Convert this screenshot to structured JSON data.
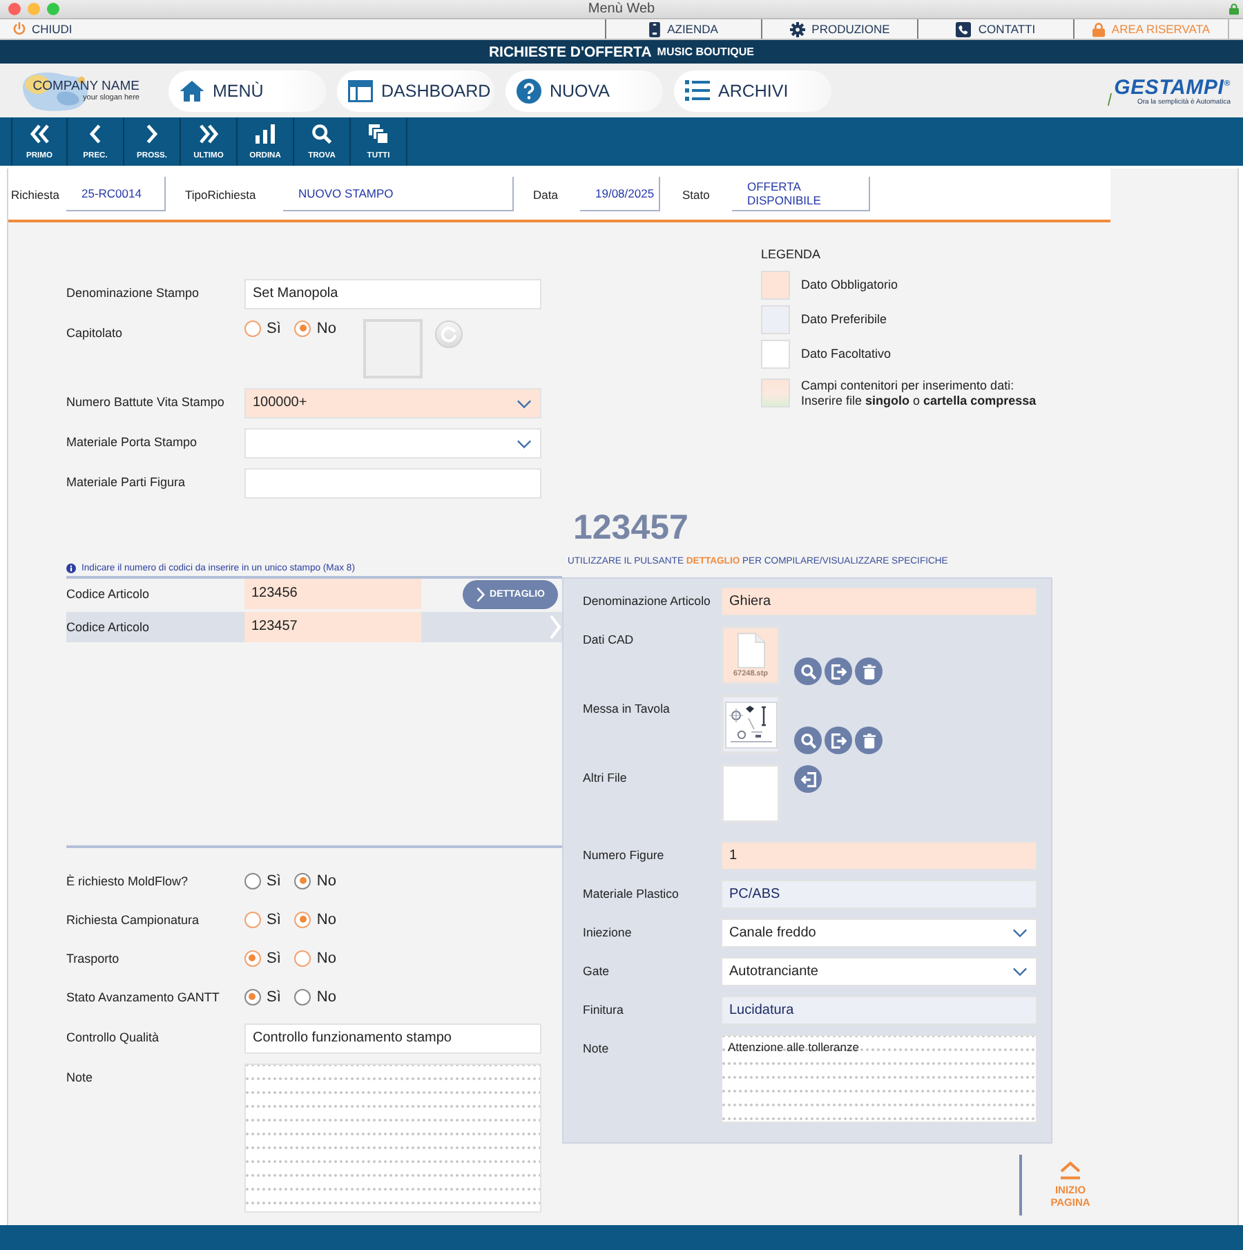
{
  "window": {
    "title": "Menù Web"
  },
  "top_bar": {
    "close": "CHIUDI",
    "links": [
      {
        "label": "AZIENDA",
        "highlighted": false
      },
      {
        "label": "PRODUZIONE",
        "highlighted": false
      },
      {
        "label": "CONTATTI",
        "highlighted": false
      },
      {
        "label": "AREA RISERVATA",
        "highlighted": true
      }
    ]
  },
  "title_bar": {
    "title": "RICHIESTE D'OFFERTA",
    "subtitle": "MUSIC BOUTIQUE"
  },
  "nav": {
    "logo": {
      "name": "COMPANY NAME",
      "slogan": "your slogan here"
    },
    "items": [
      {
        "label": "MENÙ"
      },
      {
        "label": "DASHBOARD"
      },
      {
        "label": "NUOVA"
      },
      {
        "label": "ARCHIVI"
      }
    ],
    "brand": {
      "name": "GESTAMPI$^{®}$",
      "tagline": "Ora la semplicità è Automatica"
    }
  },
  "toolbar": [
    {
      "label": "PRIMO"
    },
    {
      "label": "PREC."
    },
    {
      "label": "PROSS."
    },
    {
      "label": "ULTIMO"
    },
    {
      "label": "ORDINA"
    },
    {
      "label": "TROVA"
    },
    {
      "label": "TUTTI"
    }
  ],
  "header": [
    {
      "label": "Richiesta",
      "value": "25-RC0014"
    },
    {
      "label": "TipoRichiesta",
      "value": "NUOVO STAMPO"
    },
    {
      "label": "Data",
      "value": "19/08/2025"
    },
    {
      "label": "Stato",
      "value": "OFFERTA DISPONIBILE"
    }
  ],
  "mold": {
    "fields": [
      {
        "kind": "input",
        "label": "Denominazione Stampo",
        "value": "Set Manopola",
        "required": false
      },
      {
        "kind": "radio",
        "label": "Capitolato",
        "color": "#f2a36e",
        "attachment": true,
        "options": [
          {
            "label": "Sì",
            "selected": false
          },
          {
            "label": "No",
            "selected": true
          }
        ]
      },
      {
        "kind": "select",
        "label": "Numero Battute Vita Stampo",
        "value": "100000+",
        "required": true
      },
      {
        "kind": "select",
        "label": "Materiale Porta Stampo",
        "required": false
      },
      {
        "kind": "input",
        "label": "Materiale Parti Figura",
        "required": false
      }
    ]
  },
  "legend": {
    "title": "LEGENDA",
    "items": [
      {
        "kind": "solid",
        "label": "Dato Obbligatorio",
        "color": "#fde4d7"
      },
      {
        "kind": "solid",
        "label": "Dato Preferibile",
        "color": "#eceff5"
      },
      {
        "kind": "solid",
        "label": "Dato Facoltativo",
        "color": "#ffffff"
      },
      {
        "kind": "container",
        "label": "Campi contenitori per inserimento dati:",
        "note": "Inserire file **singolo** o **cartella compressa**"
      }
    ]
  },
  "codes": {
    "hint": "Indicare il numero di codici da inserire in un unico stampo (Max 8)",
    "rows": [
      {
        "label": "Codice Articolo",
        "value": "123456",
        "required": true,
        "selected": false,
        "button": "DETTAGLIO"
      },
      {
        "label": "Codice Articolo",
        "value": "123457",
        "required": true,
        "selected": true
      }
    ]
  },
  "options": {
    "fields": [
      {
        "kind": "radio",
        "label": "È richiesto MoldFlow?",
        "color": "#8a8a8a",
        "options": [
          {
            "label": "Sì",
            "selected": false
          },
          {
            "label": "No",
            "selected": true
          }
        ]
      },
      {
        "kind": "radio",
        "label": "Richiesta Campionatura",
        "color": "#f2a36e",
        "options": [
          {
            "label": "Sì",
            "selected": false
          },
          {
            "label": "No",
            "selected": true
          }
        ]
      },
      {
        "kind": "radio",
        "label": "Trasporto",
        "color": "#f2a36e",
        "options": [
          {
            "label": "Sì",
            "selected": true
          },
          {
            "label": "No",
            "selected": false
          }
        ]
      },
      {
        "kind": "radio",
        "label": "Stato Avanzamento GANTT",
        "color": "#8a8a8a",
        "options": [
          {
            "label": "Sì",
            "selected": true
          },
          {
            "label": "No",
            "selected": false
          }
        ]
      },
      {
        "kind": "input",
        "label": "Controllo Qualità",
        "value": "Controllo funzionamento stampo",
        "required": false
      },
      {
        "kind": "textarea",
        "label": "Note",
        "required": false
      }
    ]
  },
  "detail": {
    "code": "123457",
    "instruction": "UTILIZZARE IL PULSANTE **DETTAGLIO** PER COMPILARE/VISUALIZZARE SPECIFICHE",
    "fields": [
      {
        "kind": "input",
        "label": "Denominazione Articolo",
        "value": "Ghiera",
        "required": true,
        "preferred": false
      },
      {
        "kind": "document",
        "label": "Dati CAD",
        "file": "67248.stp",
        "required": true,
        "preferred": false,
        "actions": [
          {
            "kind": "view"
          },
          {
            "kind": "export"
          },
          {
            "kind": "delete"
          }
        ]
      },
      {
        "kind": "drawing",
        "label": "Messa in Tavola",
        "required": false,
        "preferred": true,
        "actions": [
          {
            "kind": "view"
          },
          {
            "kind": "export"
          },
          {
            "kind": "delete"
          }
        ]
      },
      {
        "kind": "dropzone",
        "label": "Altri File",
        "required": false,
        "preferred": false,
        "actions": [
          {
            "kind": "import"
          }
        ]
      },
      {
        "kind": "input",
        "label": "Numero Figure",
        "value": "1",
        "required": true,
        "preferred": false
      },
      {
        "kind": "input",
        "label": "Materiale Plastico",
        "value": "PC/ABS",
        "required": false,
        "preferred": true
      },
      {
        "kind": "select",
        "label": "Iniezione",
        "value": "Canale freddo",
        "required": false,
        "preferred": false
      },
      {
        "kind": "select",
        "label": "Gate",
        "value": "Autotranciante",
        "required": false,
        "preferred": false
      },
      {
        "kind": "input",
        "label": "Finitura",
        "value": "Lucidatura",
        "required": false,
        "preferred": true
      },
      {
        "kind": "textarea",
        "label": "Note",
        "value": "Attenzione alle tolleranze",
        "required": false,
        "preferred": false
      }
    ]
  },
  "back_to_top": "INIZIO PAGINA"
}
